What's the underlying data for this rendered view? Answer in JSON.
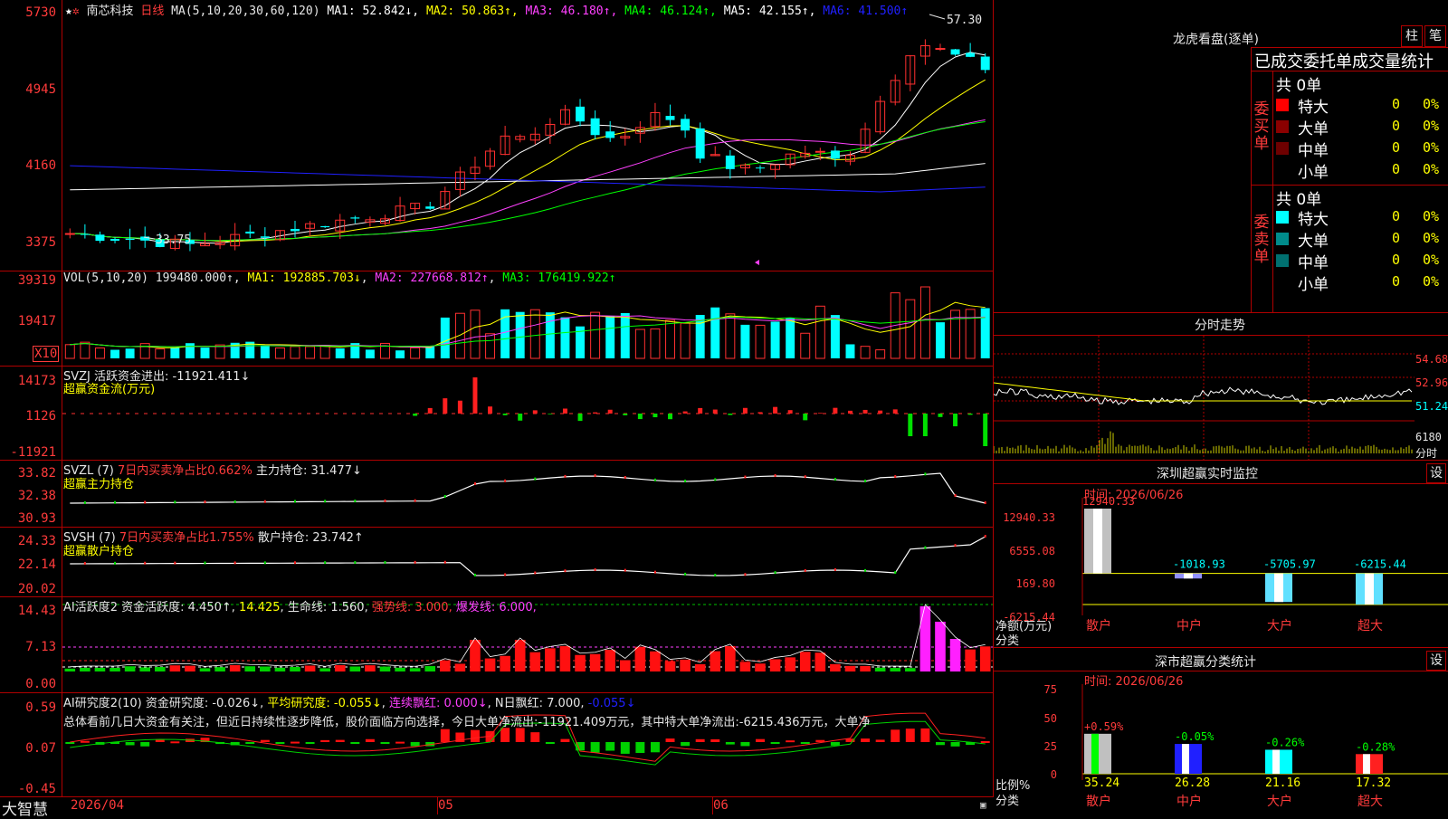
{
  "main": {
    "title_stock": "南芯科技",
    "title_period": "日线",
    "ma_header": "MA(5,10,20,30,60,120)",
    "ma_values": [
      {
        "label": "MA1: 52.842↓",
        "color": "#ffffff"
      },
      {
        "label": "MA2: 50.863↑",
        "color": "#ffff00"
      },
      {
        "label": "MA3: 46.180↑",
        "color": "#ff40ff"
      },
      {
        "label": "MA4: 46.124↑",
        "color": "#00ff00"
      },
      {
        "label": "MA5: 42.155↑",
        "color": "#ffffff"
      },
      {
        "label": "MA6: 41.500↑",
        "color": "#2020ff"
      }
    ],
    "y_labels": [
      "5730",
      "4945",
      "4160",
      "3375"
    ],
    "high_marker": "57.30",
    "low_marker": "33.75"
  },
  "vol": {
    "header": "VOL(5,10,20)",
    "value": "199480.000↑",
    "ma1": "MA1: 192885.703↓",
    "ma2": "MA2: 227668.812↑",
    "ma3": "MA3: 176419.922↑",
    "y_labels": [
      "39319",
      "19417"
    ],
    "unit": "X10"
  },
  "svzj": {
    "name": "SVZJ",
    "label": "活跃资金进出: -11921.411↓",
    "subtitle": "超赢资金流(万元)",
    "y_labels": [
      "14173",
      "1126",
      "-11921"
    ]
  },
  "svzl": {
    "name": "SVZL (7)",
    "label1": "7日内买卖净占比0.662%",
    "label2": "主力持仓: 31.477↓",
    "subtitle": "超赢主力持仓",
    "y_labels": [
      "33.82",
      "32.38",
      "30.93"
    ]
  },
  "svsh": {
    "name": "SVSH (7)",
    "label1": "7日内买卖净占比1.755%",
    "label2": "散户持仓: 23.742↑",
    "subtitle": "超赢散户持仓",
    "y_labels": [
      "24.33",
      "22.14",
      "20.02"
    ]
  },
  "ai1": {
    "name": "AI活跃度2",
    "label1": "资金活跃度: 4.450↑",
    "label2": "14.425",
    "label3": "生命线: 1.560",
    "label4": "强势线: 3.000",
    "label5": "爆发线: 6.000",
    "y_labels": [
      "14.43",
      "7.13",
      "0.00"
    ]
  },
  "ai2": {
    "name": "AI研究度2(10)",
    "label1": "资金研究度: -0.026↓",
    "label2": "平均研究度: -0.055↓",
    "label3": "连续飘红: 0.000↓",
    "label4": "N日飘红: 7.000",
    "label5": "-0.055↓",
    "summary": "总体看前几日大资金有关注，但近日持续性逐步降低，股价面临方向选择，今日大单净流出:-11921.409万元，其中特大单净流出:-6215.436万元，大单净",
    "y_labels": [
      "0.59",
      "0.07",
      "-0.45"
    ]
  },
  "bottom": {
    "brand": "大智慧",
    "dates": [
      "2026/04",
      "05",
      "06"
    ]
  },
  "right": {
    "lhb_title": "龙虎看盘(逐单)",
    "btn_zhu": "柱",
    "btn_bi": "笔",
    "tabs_text": "已成交委托单成交量统计",
    "buy_side": "委买单",
    "sell_side": "委卖单",
    "buy_total": "共 0单",
    "sell_total": "共 0单",
    "buy_rows": [
      {
        "name": "特大",
        "count": "0",
        "pct": "0%",
        "color": "#ff0000"
      },
      {
        "name": "大单",
        "count": "0",
        "pct": "0%",
        "color": "#8b0000"
      },
      {
        "name": "中单",
        "count": "0",
        "pct": "0%",
        "color": "#6e0000"
      },
      {
        "name": "小单",
        "count": "0",
        "pct": "0%",
        "color": ""
      }
    ],
    "sell_rows": [
      {
        "name": "特大",
        "count": "0",
        "pct": "0%",
        "color": "#00ffff"
      },
      {
        "name": "大单",
        "count": "0",
        "pct": "0%",
        "color": "#008b8b"
      },
      {
        "name": "中单",
        "count": "0",
        "pct": "0%",
        "color": "#007070"
      },
      {
        "name": "小单",
        "count": "0",
        "pct": "0%",
        "color": ""
      }
    ],
    "intraday_title": "分时走势",
    "intraday_y": [
      "54.68",
      "52.96",
      "51.24",
      "6180"
    ],
    "intraday_unit": "分时",
    "monitor_title": "深圳超赢实时监控",
    "monitor_btn": "设",
    "monitor_time": "时间: 2026/06/26",
    "monitor_y": [
      "12940.33",
      "6555.08",
      "169.80",
      "-6215.44"
    ],
    "monitor_unit1": "净额(万元)",
    "monitor_unit2": "分类",
    "monitor_bars": [
      {
        "name": "散户",
        "value": "12940.33"
      },
      {
        "name": "中户",
        "value": "-1018.93"
      },
      {
        "name": "大户",
        "value": "-5705.97"
      },
      {
        "name": "超大",
        "value": "-6215.44"
      }
    ],
    "stats_title": "深市超赢分类统计",
    "stats_btn": "设",
    "stats_time": "时间: 2026/06/26",
    "stats_y": [
      "75",
      "50",
      "25",
      "0"
    ],
    "stats_unit1": "比例%",
    "stats_unit2": "分类",
    "stats_bars": [
      {
        "name": "散户",
        "value": "35.24",
        "change": "+0.59%"
      },
      {
        "name": "中户",
        "value": "26.28",
        "change": "-0.05%"
      },
      {
        "name": "大户",
        "value": "21.16",
        "change": "-0.26%"
      },
      {
        "name": "超大",
        "value": "17.32",
        "change": "-0.28%"
      }
    ]
  }
}
